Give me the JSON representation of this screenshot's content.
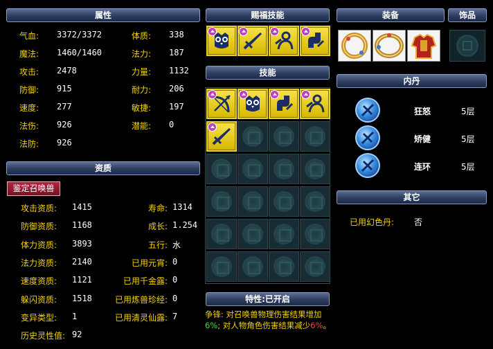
{
  "attr": {
    "title": "属性",
    "left": [
      {
        "label": "气血:",
        "value": "3372/3372"
      },
      {
        "label": "魔法:",
        "value": "1460/1460"
      },
      {
        "label": "攻击:",
        "value": "2478"
      },
      {
        "label": "防御:",
        "value": "915"
      },
      {
        "label": "速度:",
        "value": "277"
      },
      {
        "label": "法伤:",
        "value": "926"
      },
      {
        "label": "法防:",
        "value": "926"
      }
    ],
    "right": [
      {
        "label": "体质:",
        "value": "338"
      },
      {
        "label": "法力:",
        "value": "187"
      },
      {
        "label": "力量:",
        "value": "1132"
      },
      {
        "label": "耐力:",
        "value": "206"
      },
      {
        "label": "敏捷:",
        "value": "197"
      },
      {
        "label": "潜能:",
        "value": "0"
      }
    ]
  },
  "aptitude": {
    "title": "资质",
    "appraise_button": "鉴定召唤兽",
    "left": [
      {
        "label": "攻击资质:",
        "value": "1415"
      },
      {
        "label": "防御资质:",
        "value": "1168"
      },
      {
        "label": "体力资质:",
        "value": "3893"
      },
      {
        "label": "法力资质:",
        "value": "2140"
      },
      {
        "label": "速度资质:",
        "value": "1121"
      },
      {
        "label": "躲闪资质:",
        "value": "1518"
      },
      {
        "label": "变异类型:",
        "value": "1"
      },
      {
        "label": "历史灵性值:",
        "value": "92"
      }
    ],
    "right": [
      {
        "label": "寿命:",
        "value": "1314"
      },
      {
        "label": "成长:",
        "value": "1.254"
      },
      {
        "label": "五行:",
        "value": "水"
      },
      {
        "label": "已用元宵:",
        "value": "0"
      },
      {
        "label": "已用千金露:",
        "value": "0"
      },
      {
        "label": "已用炼兽珍经:",
        "value": "0"
      },
      {
        "label": "已用清灵仙露:",
        "value": "7"
      }
    ]
  },
  "gifted": {
    "title": "赐福技能",
    "icons": [
      "owl-icon",
      "sword-icon",
      "figure-icon",
      "arm-icon"
    ]
  },
  "skills": {
    "title": "技能",
    "icons": [
      "bow-icon",
      "owl-icon",
      "arm-icon",
      "figure-icon",
      "sword-icon"
    ]
  },
  "traits": {
    "title": "特性:已开启",
    "line1": "争锋: 对召唤兽物理伤害结果增加",
    "line2_pct1": "6%",
    "line2_mid": "; 对人物角色伤害结果减少",
    "line2_pct2": "6%",
    "line2_end": "。",
    "colors": {
      "label": "#f2d200",
      "pct_green": "#3ee03e",
      "pct_red": "#ff4040"
    }
  },
  "equipment": {
    "title": "装备",
    "items": [
      "ring-icon",
      "bracelet-icon",
      "armor-icon"
    ]
  },
  "ornament": {
    "title": "饰品",
    "slot": "empty-slot-icon"
  },
  "inner_dan": {
    "title": "内丹",
    "items": [
      {
        "icon": "inner-dan-icon",
        "name": "狂怒",
        "level": "5层"
      },
      {
        "icon": "inner-dan-icon",
        "name": "矫健",
        "level": "5层"
      },
      {
        "icon": "inner-dan-icon",
        "name": "连环",
        "level": "5层"
      }
    ]
  },
  "other": {
    "title": "其它",
    "label": "已用幻色丹:",
    "value": "否"
  }
}
